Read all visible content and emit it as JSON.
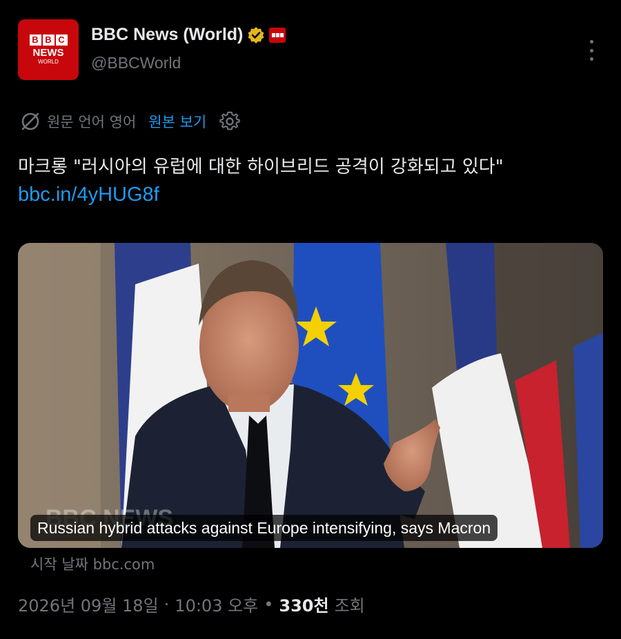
{
  "account": {
    "avatar_text": {
      "top": "BBC",
      "middle": "NEWS",
      "bottom": "WORLD"
    },
    "display_name": "BBC News (World)",
    "handle": "@BBCWorld",
    "verified_badge": "gold-verified-icon",
    "affiliate_badge": "bbc-affiliate-badge"
  },
  "translation": {
    "language_label": "원문 언어 영어",
    "show_original": "원본 보기"
  },
  "tweet": {
    "text": "마크롱 \"러시아의 유럽에 대한 하이브리드 공격이 강화되고 있다\"",
    "link": "bbc.in/4yHUG8f"
  },
  "card": {
    "title": "Russian hybrid attacks against Europe intensifying, says Macron",
    "source": "시작 날짜 bbc.com"
  },
  "meta": {
    "date": "2026년 09월 18일",
    "separator": "·",
    "time": "10:03 오후",
    "separator2": "•",
    "views_count": "330천",
    "views_label": "조회"
  },
  "colors": {
    "background": "#000000",
    "text": "#e7e9ea",
    "muted": "#71767b",
    "link": "#1d9bf0",
    "bbc_red": "#c7070b",
    "verified_gold": "#e2b719"
  }
}
